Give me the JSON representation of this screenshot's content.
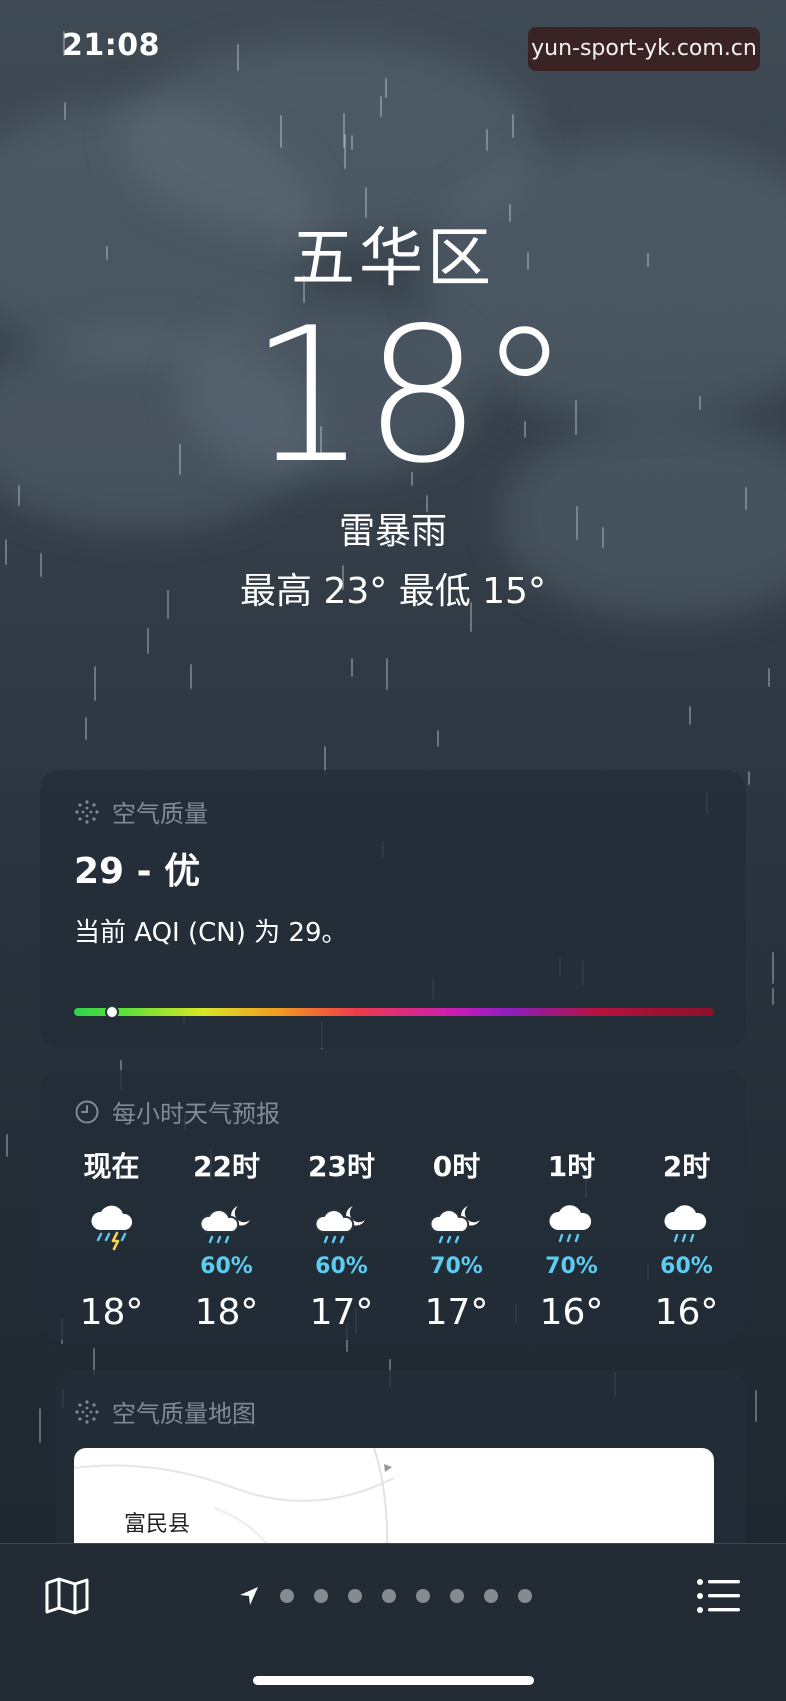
{
  "status_bar": {
    "time": "21:08"
  },
  "watermark": "yun-sport-yk.com.cn",
  "header": {
    "city": "五华区",
    "temperature": "18°",
    "condition": "雷暴雨",
    "high_low": "最高 23°  最低 15°"
  },
  "air_quality": {
    "label": "空气质量",
    "value": "29 - 优",
    "description": "当前 AQI (CN) 为 29。",
    "level_fraction": 0.06
  },
  "hourly": {
    "label": "每小时天气预报",
    "items": [
      {
        "time": "现在",
        "icon": "thunderstorm-icon",
        "prob": "",
        "temp": "18°"
      },
      {
        "time": "22时",
        "icon": "cloud-moon-rain-icon",
        "prob": "60%",
        "temp": "18°"
      },
      {
        "time": "23时",
        "icon": "cloud-moon-rain-icon",
        "prob": "60%",
        "temp": "17°"
      },
      {
        "time": "0时",
        "icon": "cloud-moon-rain-icon",
        "prob": "70%",
        "temp": "17°"
      },
      {
        "time": "1时",
        "icon": "cloud-rain-icon",
        "prob": "70%",
        "temp": "16°"
      },
      {
        "time": "2时",
        "icon": "cloud-rain-icon",
        "prob": "60%",
        "temp": "16°"
      }
    ]
  },
  "aqi_map": {
    "label": "空气质量地图",
    "place": "富民县"
  },
  "toolbar": {
    "page_dots": 8,
    "map_icon": "map-icon",
    "location_icon": "location-arrow-icon",
    "list_icon": "list-icon"
  },
  "colors": {
    "precip_blue": "#5ecbf0",
    "background_dark": "#222b34"
  }
}
